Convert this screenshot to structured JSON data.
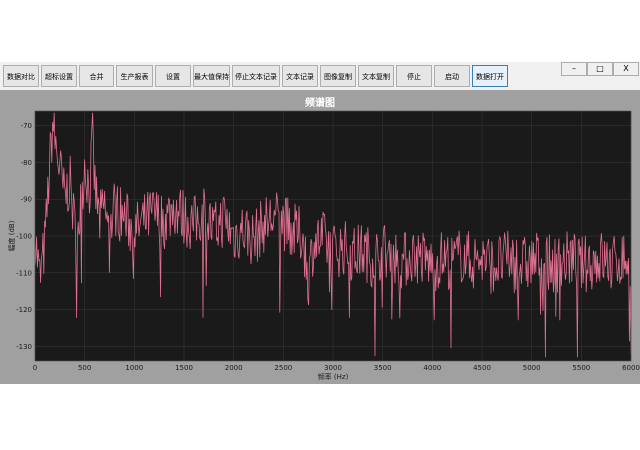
{
  "toolbar": {
    "buttons": [
      "数据对比",
      "超标设置",
      "合并",
      "生产报表",
      "设置",
      "最大值保持",
      "停止文本记录",
      "文本记录",
      "图像复制",
      "文本复制",
      "停止",
      "启动",
      "数据打开"
    ],
    "active_index": 12
  },
  "window_controls": {
    "minimize": "–",
    "maximize": "□",
    "close": "X"
  },
  "chart_data": {
    "type": "line",
    "title": "频谱图",
    "xlabel": "频率 (Hz)",
    "ylabel": "幅度 (dB)",
    "xlim": [
      0,
      6000
    ],
    "ylim": [
      -134,
      -66
    ],
    "xticks": [
      0,
      500,
      1000,
      1500,
      2000,
      2500,
      3000,
      3500,
      4000,
      4500,
      5000,
      5500,
      6000
    ],
    "yticks": [
      -70,
      -80,
      -90,
      -100,
      -110,
      -120,
      -130
    ],
    "grid": true,
    "colors": {
      "line": "#e07090",
      "plot_bg": "#1a1a1a",
      "frame_bg": "#a0a0a0",
      "grid": "#3a3a3a"
    },
    "series": [
      {
        "x": [
          0,
          50,
          100,
          150,
          180,
          200,
          250,
          300,
          350,
          400,
          450,
          500,
          550,
          580,
          600,
          650,
          700,
          750,
          800,
          900,
          1000,
          1100,
          1200,
          1300,
          1400,
          1500,
          1600,
          1700,
          1800,
          1900,
          2000,
          2100,
          2200,
          2300,
          2400,
          2500,
          2600,
          2700,
          2750,
          2800,
          2900,
          3000,
          3100,
          3200,
          3300,
          3400,
          3500,
          3600,
          3700,
          3800,
          3900,
          4000,
          4100,
          4200,
          4300,
          4400,
          4500,
          4600,
          4700,
          4800,
          4900,
          5000,
          5100,
          5200,
          5300,
          5400,
          5500,
          5600,
          5700,
          5800,
          5900,
          6000
        ],
        "y": [
          -100,
          -112,
          -102,
          -80,
          -69,
          -74,
          -82,
          -90,
          -85,
          -98,
          -95,
          -80,
          -88,
          -73,
          -86,
          -96,
          -92,
          -100,
          -92,
          -95,
          -99,
          -96,
          -94,
          -96,
          -92,
          -95,
          -97,
          -93,
          -99,
          -95,
          -100,
          -98,
          -101,
          -97,
          -95,
          -96,
          -99,
          -100,
          -112,
          -102,
          -101,
          -104,
          -103,
          -105,
          -104,
          -106,
          -104,
          -105,
          -107,
          -105,
          -106,
          -108,
          -106,
          -107,
          -105,
          -107,
          -106,
          -108,
          -107,
          -106,
          -108,
          -107,
          -106,
          -108,
          -107,
          -106,
          -108,
          -107,
          -106,
          -108,
          -106,
          -107
        ]
      }
    ]
  }
}
